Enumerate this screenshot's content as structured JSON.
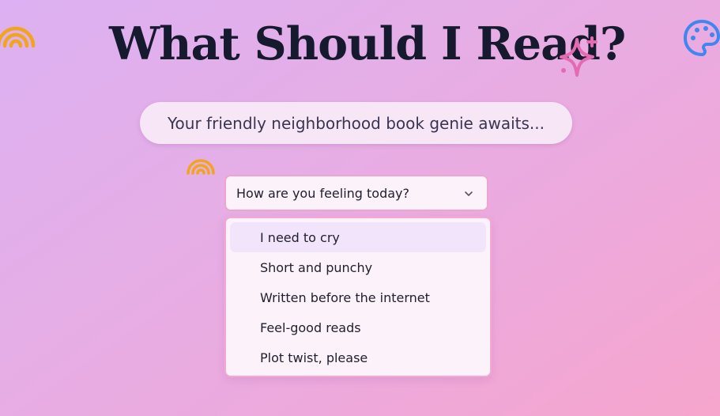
{
  "header": {
    "title": "What Should I Read?",
    "subtitle": "Your friendly neighborhood book genie awaits..."
  },
  "mood_select": {
    "placeholder": "How are you feeling today?",
    "options": [
      "I need to cry",
      "Short and punchy",
      "Written before the internet",
      "Feel-good reads",
      "Plot twist, please"
    ],
    "highlighted_index": 0
  },
  "decorations": {
    "rainbow_icon": "rainbow-icon",
    "sparkle_icon": "sparkle-icon",
    "palette_icon": "palette-icon",
    "colors": {
      "rainbow": "#f0a51c",
      "sparkle": "#e46ab2",
      "palette": "#3f86f0",
      "title": "#161a2e"
    }
  }
}
